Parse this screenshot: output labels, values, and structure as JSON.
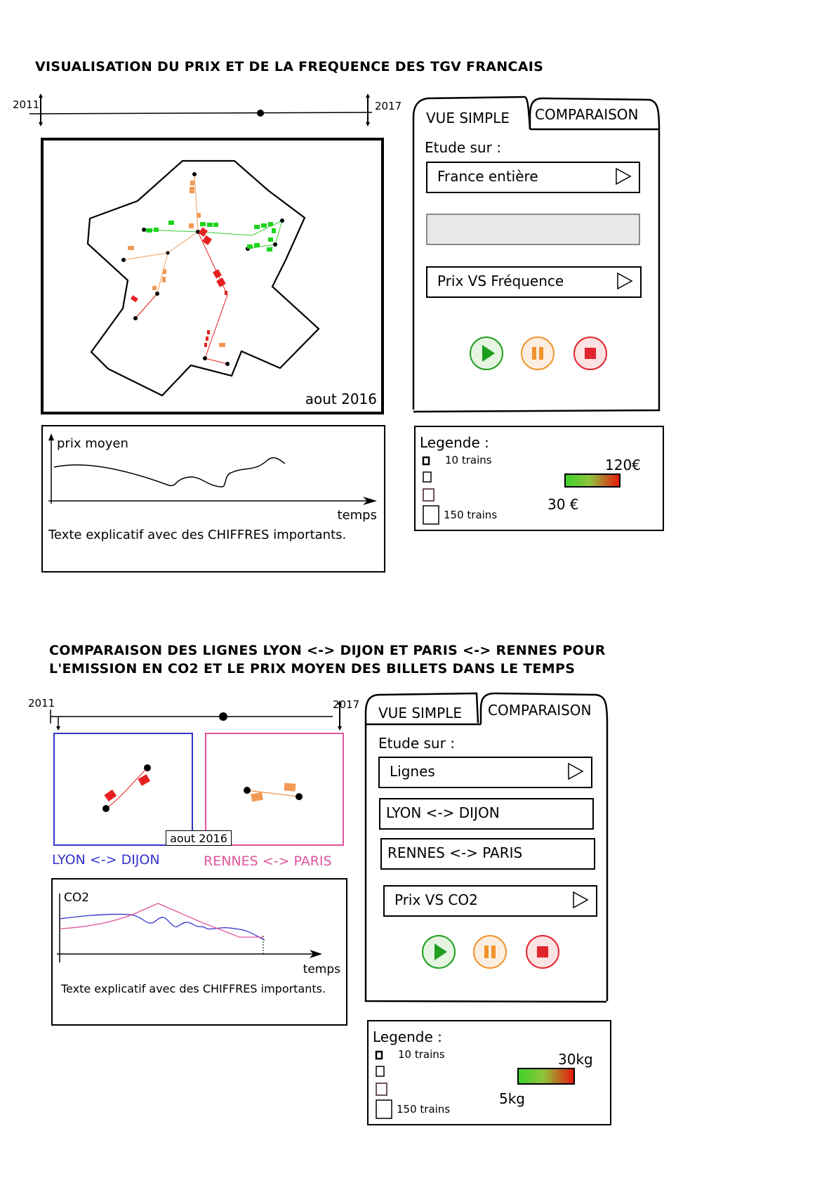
{
  "section1": {
    "title": "VISUALISATION DU PRIX ET DE LA FREQUENCE DES TGV FRANCAIS",
    "timeline": {
      "start": "2011",
      "end": "2017"
    },
    "map": {
      "date_label": "aout 2016"
    },
    "chart": {
      "ylabel": "prix moyen",
      "xlabel": "temps",
      "description": "Texte explicatif avec des CHIFFRES importants."
    },
    "panel": {
      "tabs": [
        "VUE SIMPLE",
        "COMPARAISON"
      ],
      "active_tab": "VUE SIMPLE",
      "study_label": "Etude sur :",
      "select_scope": "France entière",
      "empty_field": "",
      "select_metric": "Prix VS Fréquence",
      "controls": [
        "play-icon",
        "pause-icon",
        "stop-icon"
      ]
    },
    "legend": {
      "title": "Legende :",
      "min_trains": "10 trains",
      "max_trains": "150 trains",
      "max_value": "120€",
      "min_value": "30 €",
      "colors": {
        "low": "#3fd12a",
        "high": "#e8180e"
      }
    }
  },
  "section2": {
    "title": "COMPARAISON DES LIGNES LYON <-> DIJON ET PARIS <-> RENNES POUR\nL'EMISSION EN CO2 ET LE PRIX MOYEN DES BILLETS DANS LE TEMPS",
    "timeline": {
      "start": "2011",
      "end": "2017"
    },
    "maps": {
      "left_label": "LYON <-> DIJON",
      "right_label": "RENNES <-> PARIS",
      "date_label": "aout 2016",
      "left_color": "#3333cc",
      "right_color": "#e0559c"
    },
    "chart": {
      "ylabel": "CO2",
      "xlabel": "temps",
      "description": "Texte explicatif avec des CHIFFRES importants."
    },
    "panel": {
      "tabs": [
        "VUE SIMPLE",
        "COMPARAISON"
      ],
      "active_tab": "COMPARAISON",
      "study_label": "Etude sur :",
      "select_scope": "Lignes",
      "line_one": "LYON <-> DIJON",
      "line_two": "RENNES <-> PARIS",
      "select_metric": "Prix VS CO2",
      "controls": [
        "play-icon",
        "pause-icon",
        "stop-icon"
      ]
    },
    "legend": {
      "title": "Legende :",
      "min_trains": "10 trains",
      "max_trains": "150 trains",
      "max_value": "30kg",
      "min_value": "5kg"
    }
  }
}
